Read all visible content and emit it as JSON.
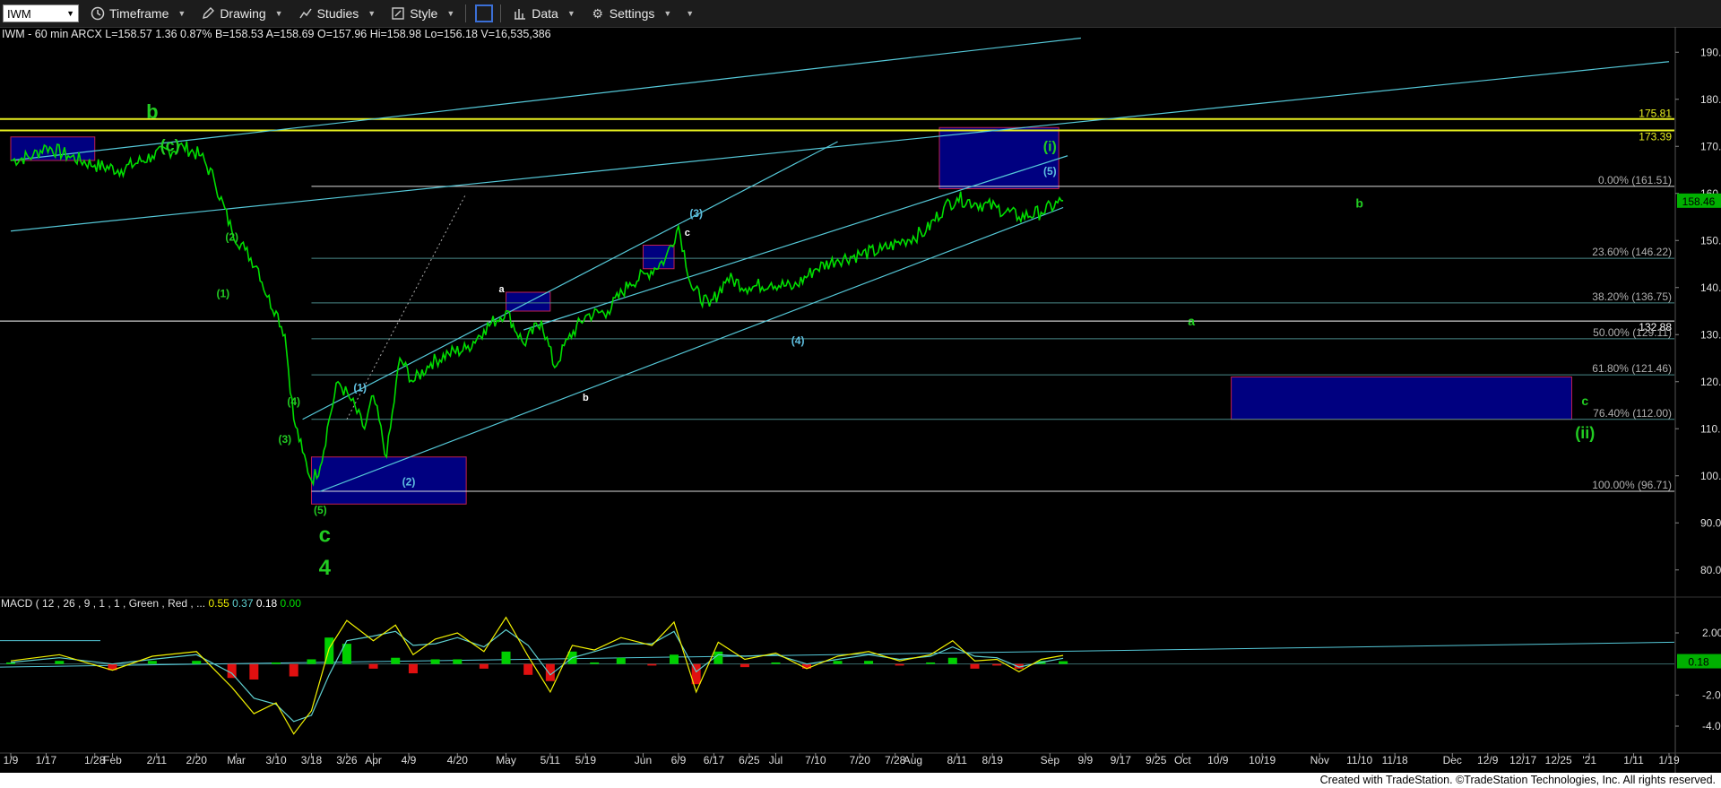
{
  "toolbar": {
    "symbol": "IWM",
    "timeframe": "Timeframe",
    "drawing": "Drawing",
    "studies": "Studies",
    "style": "Style",
    "data": "Data",
    "settings": "Settings"
  },
  "info_line": "IWM - 60 min  ARCX  L=158.57  1.36  0.87%  B=158.53  A=158.69  O=157.96  Hi=158.98  Lo=156.18  V=16,535,386",
  "macd": {
    "label": "MACD ( 12 , 26 , 9 , 1 , 1 , Green , Red , ...",
    "v1": "0.55",
    "v2": "0.37",
    "v3": "0.18",
    "v4": "0.00",
    "v1_color": "#f2f200",
    "v2_color": "#5fd0d0",
    "v3_color": "#ffffff",
    "v4_color": "#00e000"
  },
  "footer": "Created with TradeStation. ©TradeStation Technologies, Inc. All rights reserved.",
  "colors": {
    "price": "#00dd00",
    "trendline": "#55c8d8",
    "fib": "#b0b0b0",
    "box_fill": "#000080",
    "box_border": "#c02050",
    "yellow": "#e8f020",
    "wave_green": "#22cc22",
    "wave_cyan": "#5fbfe0"
  },
  "chart_data": {
    "type": "line",
    "title": "",
    "xlabel": "",
    "ylabel": "",
    "ylim": [
      75,
      195
    ],
    "x_range": [
      "2025-01-09",
      "2026-01-19"
    ],
    "y_ticks": [
      "190.00",
      "180.00",
      "170.00",
      "160.00",
      "150.00",
      "140.00",
      "130.00",
      "120.00",
      "110.00",
      "100.00",
      "90.00",
      "80.00"
    ],
    "x_ticks": [
      {
        "label": "1/9",
        "date": "2025-01-09"
      },
      {
        "label": "1/17",
        "date": "2025-01-17"
      },
      {
        "label": "1/28",
        "date": "2025-01-28"
      },
      {
        "label": "Feb",
        "date": "2025-02-01"
      },
      {
        "label": "2/11",
        "date": "2025-02-11"
      },
      {
        "label": "2/20",
        "date": "2025-02-20"
      },
      {
        "label": "Mar",
        "date": "2025-03-01"
      },
      {
        "label": "3/10",
        "date": "2025-03-10"
      },
      {
        "label": "3/18",
        "date": "2025-03-18"
      },
      {
        "label": "3/26",
        "date": "2025-03-26"
      },
      {
        "label": "Apr",
        "date": "2025-04-01"
      },
      {
        "label": "4/9",
        "date": "2025-04-09"
      },
      {
        "label": "4/20",
        "date": "2025-04-20"
      },
      {
        "label": "May",
        "date": "2025-05-01"
      },
      {
        "label": "5/11",
        "date": "2025-05-11"
      },
      {
        "label": "5/19",
        "date": "2025-05-19"
      },
      {
        "label": "Jun",
        "date": "2025-06-01"
      },
      {
        "label": "6/9",
        "date": "2025-06-09"
      },
      {
        "label": "6/17",
        "date": "2025-06-17"
      },
      {
        "label": "6/25",
        "date": "2025-06-25"
      },
      {
        "label": "Jul",
        "date": "2025-07-01"
      },
      {
        "label": "7/10",
        "date": "2025-07-10"
      },
      {
        "label": "7/20",
        "date": "2025-07-20"
      },
      {
        "label": "7/28",
        "date": "2025-07-28"
      },
      {
        "label": "Aug",
        "date": "2025-08-01"
      },
      {
        "label": "8/11",
        "date": "2025-08-11"
      },
      {
        "label": "8/19",
        "date": "2025-08-19"
      },
      {
        "label": "Sep",
        "date": "2025-09-01"
      },
      {
        "label": "9/9",
        "date": "2025-09-09"
      },
      {
        "label": "9/17",
        "date": "2025-09-17"
      },
      {
        "label": "9/25",
        "date": "2025-09-25"
      },
      {
        "label": "Oct",
        "date": "2025-10-01"
      },
      {
        "label": "10/9",
        "date": "2025-10-09"
      },
      {
        "label": "10/19",
        "date": "2025-10-19"
      },
      {
        "label": "Nov",
        "date": "2025-11-01"
      },
      {
        "label": "11/10",
        "date": "2025-11-10"
      },
      {
        "label": "11/18",
        "date": "2025-11-18"
      },
      {
        "label": "Dec",
        "date": "2025-12-01"
      },
      {
        "label": "12/9",
        "date": "2025-12-09"
      },
      {
        "label": "12/17",
        "date": "2025-12-17"
      },
      {
        "label": "12/25",
        "date": "2025-12-25"
      },
      {
        "label": "'21",
        "date": "2026-01-01"
      },
      {
        "label": "1/11",
        "date": "2026-01-11"
      },
      {
        "label": "1/19",
        "date": "2026-01-19"
      }
    ],
    "price_series": {
      "x": [
        "2025-01-09",
        "2025-01-14",
        "2025-01-17",
        "2025-01-22",
        "2025-01-28",
        "2025-02-03",
        "2025-02-10",
        "2025-02-17",
        "2025-02-21",
        "2025-02-24",
        "2025-02-28",
        "2025-03-03",
        "2025-03-06",
        "2025-03-08",
        "2025-03-10",
        "2025-03-12",
        "2025-03-14",
        "2025-03-16",
        "2025-03-18",
        "2025-03-20",
        "2025-03-22",
        "2025-03-24",
        "2025-03-27",
        "2025-03-30",
        "2025-04-01",
        "2025-04-04",
        "2025-04-07",
        "2025-04-10",
        "2025-04-14",
        "2025-04-18",
        "2025-04-22",
        "2025-04-26",
        "2025-05-01",
        "2025-05-05",
        "2025-05-09",
        "2025-05-12",
        "2025-05-15",
        "2025-05-19",
        "2025-05-24",
        "2025-05-29",
        "2025-06-02",
        "2025-06-06",
        "2025-06-09",
        "2025-06-12",
        "2025-06-16",
        "2025-06-20",
        "2025-06-25",
        "2025-06-30",
        "2025-07-05",
        "2025-07-10",
        "2025-07-15",
        "2025-07-20",
        "2025-07-25",
        "2025-07-30",
        "2025-08-04",
        "2025-08-08",
        "2025-08-11",
        "2025-08-15",
        "2025-08-20",
        "2025-08-25",
        "2025-08-30",
        "2025-09-04"
      ],
      "y": [
        167,
        168,
        170,
        168,
        166,
        165,
        168,
        170,
        168,
        163,
        152,
        148,
        144,
        138,
        135,
        130,
        112,
        105,
        99,
        102,
        112,
        120,
        116,
        110,
        117,
        104,
        125,
        120,
        124,
        126,
        127,
        131,
        135,
        128,
        133,
        123,
        129,
        134,
        135,
        141,
        143,
        146,
        153,
        140,
        136,
        142,
        140,
        141,
        140,
        144,
        146,
        147,
        148,
        150,
        152,
        157,
        159,
        158,
        157,
        155,
        156,
        158.46
      ]
    },
    "last_price": "158.46",
    "horizontal_levels": [
      {
        "label": "175.81",
        "value": 175.81,
        "color": "#e8f020"
      },
      {
        "label": "173.39",
        "value": 173.39,
        "color": "#e8f020"
      },
      {
        "label": "132.88",
        "value": 132.88,
        "color": "#ffffff"
      }
    ],
    "fib_levels": [
      {
        "label": "0.00% (161.51)",
        "value": 161.51
      },
      {
        "label": "23.60% (146.22)",
        "value": 146.22
      },
      {
        "label": "38.20% (136.75)",
        "value": 136.75
      },
      {
        "label": "50.00% (129.11)",
        "value": 129.11
      },
      {
        "label": "61.80% (121.46)",
        "value": 121.46
      },
      {
        "label": "76.40% (112.00)",
        "value": 112.0
      },
      {
        "label": "100.00% (96.71)",
        "value": 96.71
      }
    ],
    "boxes": [
      {
        "x0": "2025-01-09",
        "x1": "2025-01-28",
        "y0": 167,
        "y1": 172
      },
      {
        "x0": "2025-03-18",
        "x1": "2025-04-22",
        "y0": 94,
        "y1": 104
      },
      {
        "x0": "2025-05-01",
        "x1": "2025-05-11",
        "y0": 135,
        "y1": 139
      },
      {
        "x0": "2025-06-01",
        "x1": "2025-06-08",
        "y0": 144,
        "y1": 149
      },
      {
        "x0": "2025-08-07",
        "x1": "2025-09-03",
        "y0": 161,
        "y1": 174
      },
      {
        "x0": "2025-10-12",
        "x1": "2025-12-28",
        "y0": 112,
        "y1": 121
      }
    ],
    "trendlines": [
      {
        "x0": "2025-01-09",
        "y0": 167,
        "x1": "2025-09-08",
        "y1": 193
      },
      {
        "x0": "2025-01-09",
        "y0": 152,
        "x1": "2026-01-19",
        "y1": 188
      },
      {
        "x0": "2025-03-16",
        "y0": 112,
        "x1": "2025-07-15",
        "y1": 171
      },
      {
        "x0": "2025-03-20",
        "y0": 96.71,
        "x1": "2025-09-04",
        "y1": 157
      },
      {
        "x0": "2025-05-05",
        "y0": 131,
        "x1": "2025-09-05",
        "y1": 168
      }
    ],
    "wave_labels": [
      {
        "text": "b",
        "x": "2025-02-10",
        "y": 176,
        "size": 22,
        "color": "#22cc22"
      },
      {
        "text": "(c)",
        "x": "2025-02-14",
        "y": 169,
        "size": 18,
        "color": "#22cc22"
      },
      {
        "text": "(2)",
        "x": "2025-02-28",
        "y": 150,
        "size": 12,
        "color": "#22cc22"
      },
      {
        "text": "(1)",
        "x": "2025-02-26",
        "y": 138,
        "size": 12,
        "color": "#22cc22"
      },
      {
        "text": "(4)",
        "x": "2025-03-14",
        "y": 115,
        "size": 12,
        "color": "#22cc22"
      },
      {
        "text": "(3)",
        "x": "2025-03-12",
        "y": 107,
        "size": 12,
        "color": "#22cc22"
      },
      {
        "text": "(5)",
        "x": "2025-03-20",
        "y": 92,
        "size": 12,
        "color": "#22cc22"
      },
      {
        "text": "c",
        "x": "2025-03-21",
        "y": 86,
        "size": 24,
        "color": "#22cc22"
      },
      {
        "text": "4",
        "x": "2025-03-21",
        "y": 79,
        "size": 24,
        "color": "#22cc22"
      },
      {
        "text": "(1)",
        "x": "2025-03-29",
        "y": 118,
        "size": 12,
        "color": "#5fbfe0"
      },
      {
        "text": "(2)",
        "x": "2025-04-09",
        "y": 98,
        "size": 12,
        "color": "#5fbfe0"
      },
      {
        "text": "a",
        "x": "2025-04-30",
        "y": 139,
        "size": 11,
        "color": "#ffffff"
      },
      {
        "text": "b",
        "x": "2025-05-19",
        "y": 116,
        "size": 11,
        "color": "#ffffff"
      },
      {
        "text": "(3)",
        "x": "2025-06-13",
        "y": 155,
        "size": 12,
        "color": "#5fbfe0"
      },
      {
        "text": "c",
        "x": "2025-06-11",
        "y": 151,
        "size": 11,
        "color": "#ffffff"
      },
      {
        "text": "(4)",
        "x": "2025-07-06",
        "y": 128,
        "size": 12,
        "color": "#5fbfe0"
      },
      {
        "text": "(5)",
        "x": "2025-09-01",
        "y": 164,
        "size": 12,
        "color": "#5fbfe0"
      },
      {
        "text": "(i)",
        "x": "2025-09-01",
        "y": 169,
        "size": 16,
        "color": "#22cc22"
      },
      {
        "text": "b",
        "x": "2025-11-10",
        "y": 157,
        "size": 14,
        "color": "#22cc22"
      },
      {
        "text": "a",
        "x": "2025-10-03",
        "y": 132,
        "size": 14,
        "color": "#22cc22"
      },
      {
        "text": "c",
        "x": "2025-12-31",
        "y": 115,
        "size": 14,
        "color": "#22cc22"
      },
      {
        "text": "(ii)",
        "x": "2025-12-31",
        "y": 108,
        "size": 18,
        "color": "#22cc22"
      }
    ],
    "macd_panel": {
      "ylim": [
        -5.5,
        3.5
      ],
      "y_ticks": [
        "2.00",
        "-2.00",
        "-4.00"
      ],
      "last_value": "0.18",
      "x": [
        "2025-01-09",
        "2025-01-20",
        "2025-02-01",
        "2025-02-10",
        "2025-02-20",
        "2025-02-28",
        "2025-03-05",
        "2025-03-10",
        "2025-03-14",
        "2025-03-18",
        "2025-03-22",
        "2025-03-26",
        "2025-04-01",
        "2025-04-06",
        "2025-04-10",
        "2025-04-15",
        "2025-04-20",
        "2025-04-26",
        "2025-05-01",
        "2025-05-06",
        "2025-05-11",
        "2025-05-16",
        "2025-05-21",
        "2025-05-27",
        "2025-06-03",
        "2025-06-08",
        "2025-06-13",
        "2025-06-18",
        "2025-06-24",
        "2025-07-01",
        "2025-07-08",
        "2025-07-15",
        "2025-07-22",
        "2025-07-29",
        "2025-08-05",
        "2025-08-10",
        "2025-08-15",
        "2025-08-20",
        "2025-08-25",
        "2025-08-30",
        "2025-09-04"
      ],
      "macd": [
        0.2,
        0.6,
        -0.4,
        0.5,
        0.8,
        -1.5,
        -3.2,
        -2.5,
        -4.5,
        -3.0,
        1.0,
        2.8,
        1.5,
        2.5,
        0.6,
        1.6,
        2.0,
        0.8,
        3.0,
        0.5,
        -1.8,
        1.2,
        0.9,
        1.7,
        1.2,
        2.7,
        -1.8,
        1.4,
        0.3,
        0.7,
        -0.3,
        0.5,
        0.8,
        0.2,
        0.6,
        1.5,
        0.2,
        0.3,
        -0.5,
        0.3,
        0.55
      ],
      "signal": [
        0.1,
        0.4,
        0.0,
        0.3,
        0.6,
        -0.6,
        -2.2,
        -2.6,
        -3.7,
        -3.3,
        -0.7,
        1.5,
        1.8,
        2.1,
        1.2,
        1.3,
        1.7,
        1.1,
        2.2,
        1.2,
        -0.7,
        0.4,
        0.8,
        1.3,
        1.3,
        2.1,
        -0.5,
        0.6,
        0.5,
        0.6,
        0.0,
        0.3,
        0.6,
        0.3,
        0.5,
        1.1,
        0.5,
        0.4,
        -0.2,
        0.1,
        0.37
      ]
    }
  }
}
